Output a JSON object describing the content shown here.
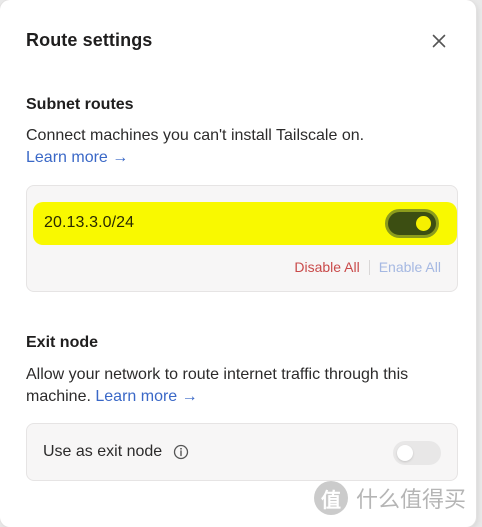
{
  "dialog": {
    "title": "Route settings",
    "close_icon": "close-icon"
  },
  "subnet": {
    "heading": "Subnet routes",
    "description": "Connect machines you can't install Tailscale on.",
    "learn_more": "Learn more →",
    "routes": [
      {
        "cidr": "20.13.3.0/24",
        "enabled": true
      }
    ],
    "disable_all": "Disable All",
    "enable_all": "Enable All",
    "highlight_color": "#f9f900"
  },
  "exit_node": {
    "heading": "Exit node",
    "description": "Allow your network to route internet traffic through this machine.",
    "learn_more": "Learn more →",
    "toggle_label": "Use as exit node",
    "info_icon": "info-icon",
    "enabled": false
  },
  "watermark": {
    "text": "什么值得买",
    "icon_char": "值"
  },
  "colors": {
    "link": "#3a68c7",
    "danger": "#c94a4a",
    "disabled_link": "#a5b8e2"
  }
}
